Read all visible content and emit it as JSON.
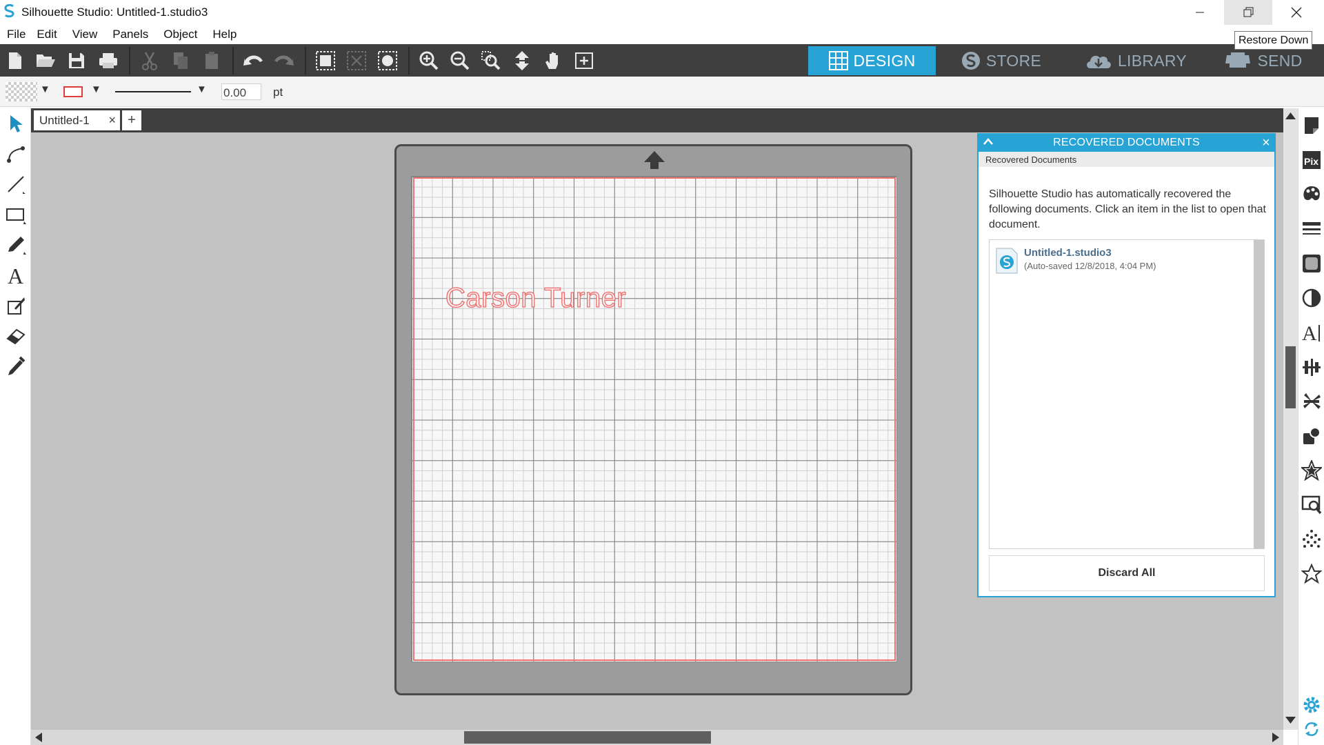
{
  "window": {
    "title": "Silhouette Studio: Untitled-1.studio3",
    "tooltip": "Restore Down"
  },
  "menu": [
    "File",
    "Edit",
    "View",
    "Panels",
    "Object",
    "Help"
  ],
  "modes": {
    "design": "DESIGN",
    "store": "STORE",
    "library": "LIBRARY",
    "send": "SEND",
    "active": "DESIGN"
  },
  "propbar": {
    "stroke_width": "0.00",
    "unit": "pt"
  },
  "tabs": {
    "doc_tab": "Untitled-1",
    "close_glyph": "×",
    "add_glyph": "+"
  },
  "canvas": {
    "design_text": "Carson Turner",
    "cut_line_color": "#f07070"
  },
  "recovered": {
    "header": "RECOVERED DOCUMENTS",
    "subheader": "Recovered Documents",
    "description": "Silhouette Studio has automatically recovered the following documents. Click an item in the list to open that document.",
    "items": [
      {
        "name": "Untitled-1.studio3",
        "meta": "(Auto-saved 12/8/2018, 4:04 PM)"
      }
    ],
    "discard_label": "Discard All",
    "close_glyph": "×"
  },
  "colors": {
    "accent": "#28a3d6",
    "toolbar": "#3f3f3f",
    "canvas_bg": "#c2c2c2"
  }
}
